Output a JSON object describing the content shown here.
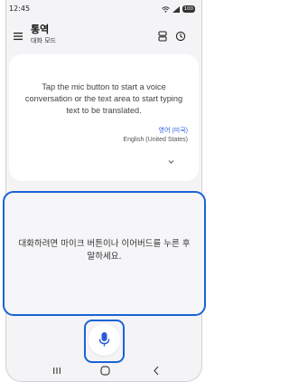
{
  "status_bar": {
    "time": "12:45",
    "battery": "100"
  },
  "header": {
    "title": "통역",
    "subtitle": "대화 모드"
  },
  "top_card": {
    "prompt": "Tap the mic button to start a voice conversation or the text area to start typing text to be translated.",
    "language_selected": "영어 (미국)",
    "language_label": "English (United States)"
  },
  "bottom_card": {
    "prompt": "대화하려면 마이크 버튼이나 이어버드를 누른 후 말하세요."
  },
  "colors": {
    "accent": "#1a63d6",
    "language_link": "#2a5bd7"
  },
  "icons": {
    "menu": "menu-icon",
    "layout": "layout-icon",
    "history": "history-icon",
    "mic": "mic-icon",
    "chevron": "chevron-down-icon"
  }
}
